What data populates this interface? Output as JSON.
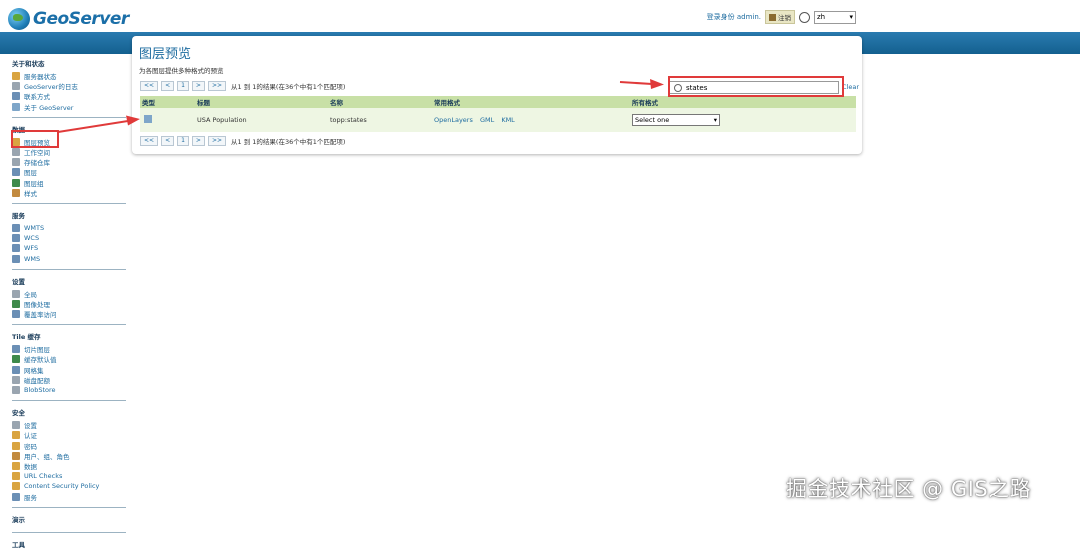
{
  "app": {
    "logo_text": "GeoServer"
  },
  "userbar": {
    "login_text": "登录身份 admin.",
    "logout_label": "注销",
    "language": "zh"
  },
  "sidebar": {
    "sections": [
      {
        "title": "关于和状态",
        "items": [
          "服务器状态",
          "GeoServer的日志",
          "联系方式",
          "关于 GeoServer"
        ]
      },
      {
        "title": "数据",
        "items": [
          "图层预览",
          "工作空间",
          "存储仓库",
          "图层",
          "图层组",
          "样式"
        ]
      },
      {
        "title": "服务",
        "items": [
          "WMTS",
          "WCS",
          "WFS",
          "WMS"
        ]
      },
      {
        "title": "设置",
        "items": [
          "全局",
          "图像处理",
          "覆盖率访问"
        ]
      },
      {
        "title": "Tile 缓存",
        "items": [
          "切片图层",
          "缓存默认值",
          "网格集",
          "磁盘配额",
          "BlobStore"
        ]
      },
      {
        "title": "安全",
        "items": [
          "设置",
          "认证",
          "密码",
          "用户、组、角色",
          "数据",
          "URL Checks",
          "Content Security Policy",
          "服务"
        ]
      },
      {
        "title": "演示",
        "items": []
      },
      {
        "title": "工具",
        "items": []
      }
    ]
  },
  "main": {
    "title": "图层预览",
    "description": "为各图层提供多种格式的预览",
    "pager": {
      "first": "<<",
      "prev": "<",
      "page": "1",
      "next": ">",
      "last": ">>",
      "summary": "从1 到 1的结果(在36个中有1个匹配项)"
    },
    "search": {
      "value": "states",
      "clear_label": "Clear"
    },
    "table": {
      "headers": [
        "类型",
        "标题",
        "名称",
        "常用格式",
        "所有格式"
      ],
      "rows": [
        {
          "title": "USA Population",
          "name": "topp:states",
          "formats": [
            "OpenLayers",
            "GML",
            "KML"
          ],
          "all_formats_selected": "Select one"
        }
      ]
    }
  },
  "watermark": "掘金技术社区 @ GIS之路",
  "colors": {
    "header_band": "#1f6f9f",
    "table_header": "#c8e0a6",
    "table_row": "#eef6e3",
    "annotation_red": "#e03a3a",
    "link": "#1e6ca0"
  }
}
